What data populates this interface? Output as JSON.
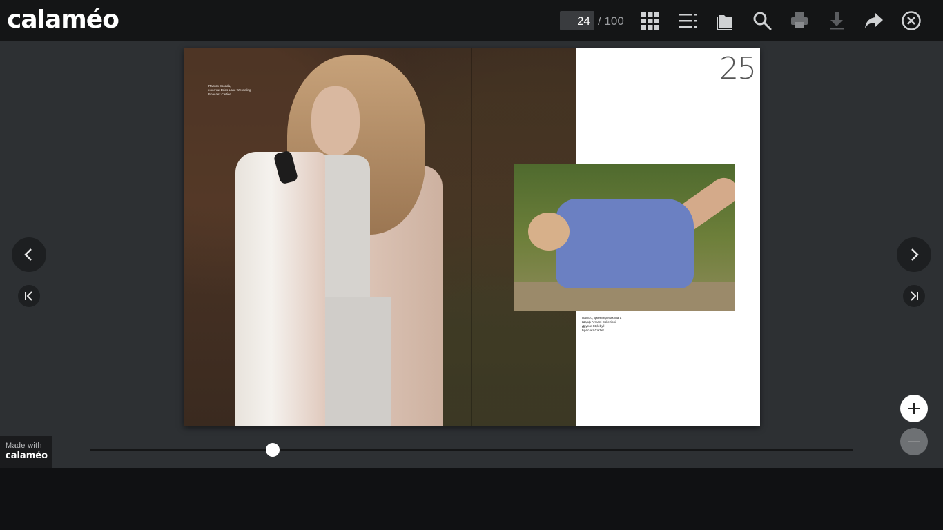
{
  "app": {
    "logo": "calaméo"
  },
  "toolbar": {
    "current_page": "24",
    "total_pages": "/ 100",
    "icons": [
      "grid-view-icon",
      "table-of-contents-icon",
      "library-icon",
      "search-icon",
      "print-icon",
      "download-icon",
      "share-icon",
      "close-icon"
    ]
  },
  "publication": {
    "page_number": "25",
    "caption_left": [
      "Пальто Escada,",
      "носочки Dries Lane Wesseling",
      "Браслет Cartier"
    ],
    "caption_right": [
      "Пальто, джемпер Max Mara",
      "Шарф Armani Collezioni",
      "Другие Stylebyll",
      "Браслет Cartier"
    ]
  },
  "navigation": {
    "prev_icon": "chevron-left-icon",
    "next_icon": "chevron-right-icon",
    "first_icon": "first-page-icon",
    "last_icon": "last-page-icon"
  },
  "zoom": {
    "in_icon": "plus-icon",
    "out_icon": "minus-icon"
  },
  "slider": {
    "progress": 0.24
  },
  "footer": {
    "made_with": "Made with",
    "brand": "calaméo"
  }
}
